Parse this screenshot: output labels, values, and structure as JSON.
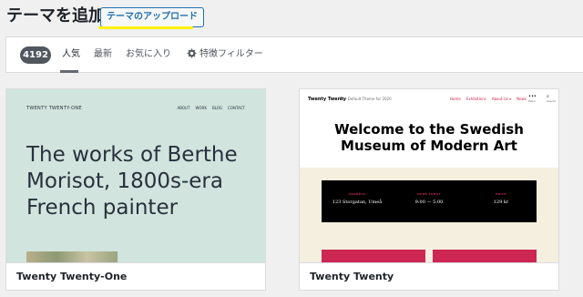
{
  "header": {
    "title": "テーマを追加",
    "upload_button": "テーマのアップロード"
  },
  "filter": {
    "count": "4192",
    "tabs": [
      "人気",
      "最新",
      "お気に入り"
    ],
    "feature_filter": "特徴フィルター",
    "current_tab": "人気"
  },
  "themes": [
    {
      "name": "Twenty Twenty-One",
      "preview": {
        "site_title": "TWENTY TWENTY-ONE",
        "menu": [
          "ABOUT",
          "WORK",
          "BLOG",
          "CONTACT"
        ],
        "heading": "The works of Berthe Morisot, 1800s-era French painter",
        "background": "#d1e4dd"
      }
    },
    {
      "name": "Twenty Twenty",
      "preview": {
        "site_title": "Twenty Twenty",
        "tagline": "The Default Theme for 2020",
        "menu": [
          "Home",
          "Exhibitions",
          "About Us ▾",
          "News"
        ],
        "menu_label": "Menu",
        "search_label": "Search",
        "heading": "Welcome to the Swedish Museum of Modern Art",
        "info": [
          {
            "label": "ADDRESS",
            "value": "123 Storgatan, Umeå"
          },
          {
            "label": "OPEN TODAY",
            "value": "9:00 — 5:00"
          },
          {
            "label": "PRICE",
            "value": "129 kr"
          }
        ],
        "accent": "#cd2653"
      }
    }
  ],
  "colors": {
    "accent_blue": "#2271b1",
    "highlight_yellow": "#fff200",
    "badge_gray": "#50575e"
  }
}
